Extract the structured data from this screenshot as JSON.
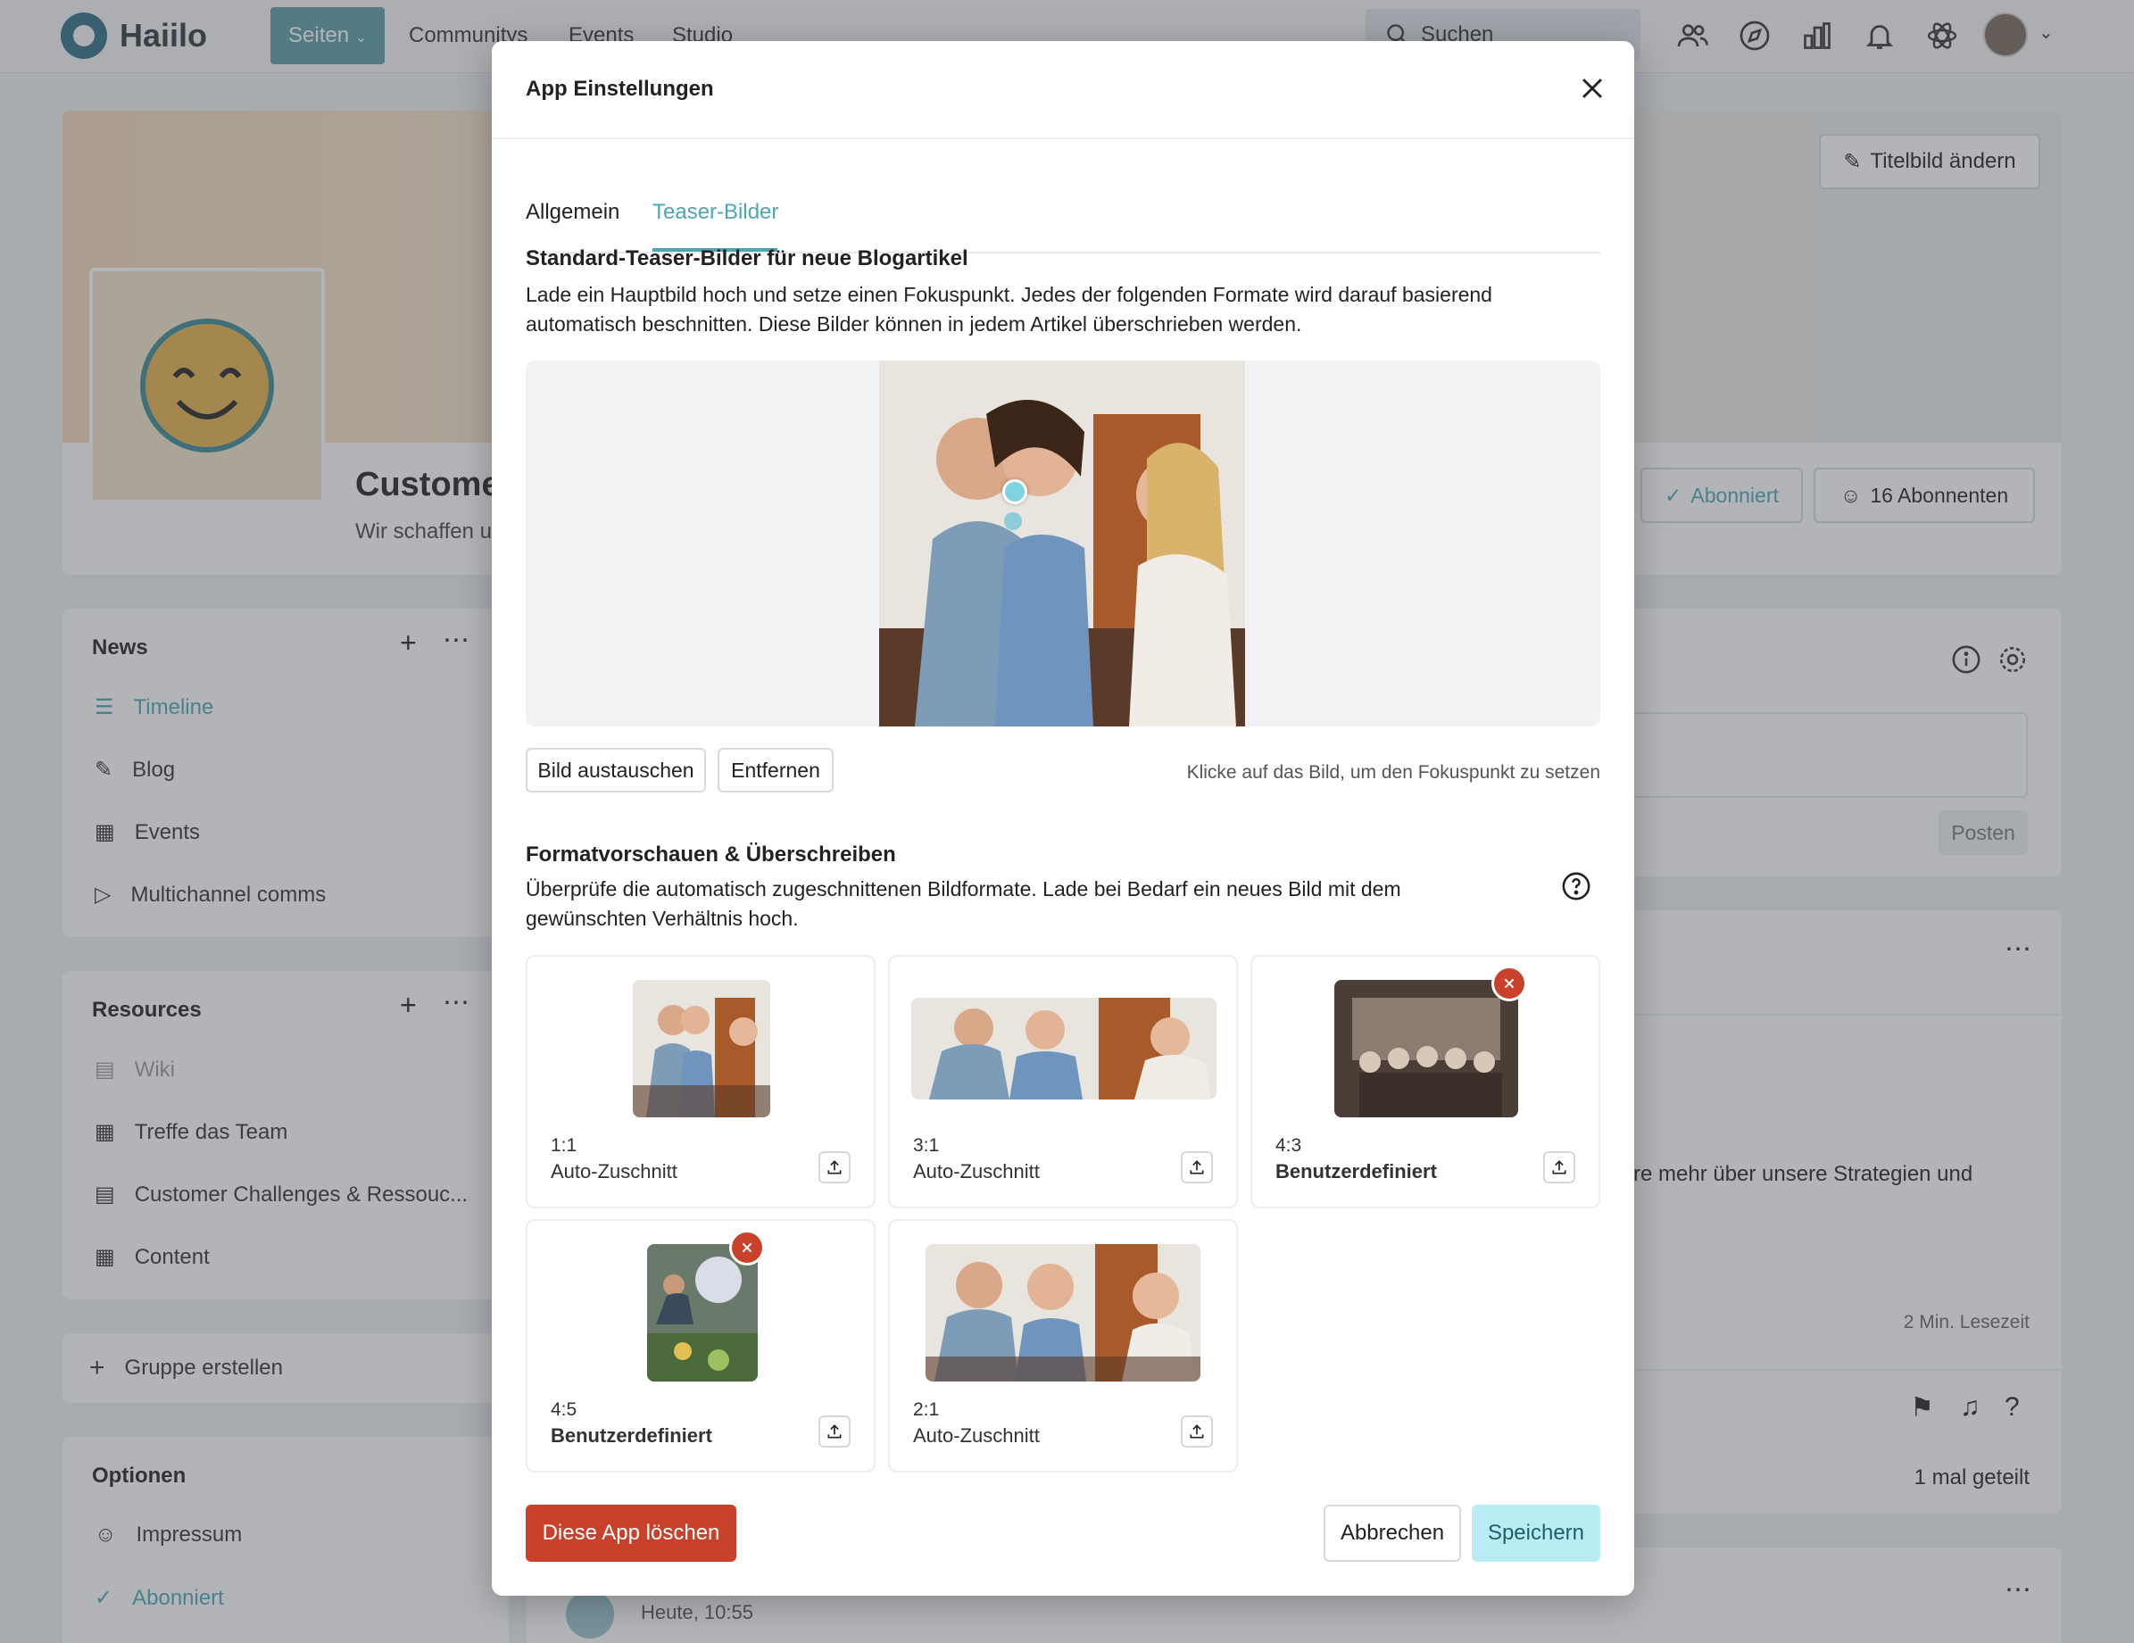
{
  "app": {
    "name": "Haiilo"
  },
  "nav": {
    "items": [
      {
        "label": "Seiten"
      },
      {
        "label": "Communitys"
      },
      {
        "label": "Events"
      },
      {
        "label": "Studio"
      }
    ],
    "search_placeholder": "Suchen"
  },
  "page": {
    "title": "Custome",
    "subtitle": "Wir schaffen u",
    "change_cover_label": "Titelbild ändern",
    "subscribed_label": "Abonniert",
    "subscribers_label": "16 Abonnenten",
    "post_button": "Posten",
    "read_time": "2 Min. Lesezeit",
    "snippet": "re mehr über unsere Strategien und",
    "shared": "1 mal geteilt",
    "timestamp": "Heute, 10:55"
  },
  "sidebar": {
    "news": {
      "title": "News",
      "items": [
        {
          "label": "Timeline"
        },
        {
          "label": "Blog"
        },
        {
          "label": "Events"
        },
        {
          "label": "Multichannel comms"
        }
      ]
    },
    "resources": {
      "title": "Resources",
      "items": [
        {
          "label": "Wiki"
        },
        {
          "label": "Treffe das Team"
        },
        {
          "label": "Customer Challenges & Ressouc..."
        },
        {
          "label": "Content"
        }
      ]
    },
    "create_group": "Gruppe erstellen",
    "options": {
      "title": "Optionen",
      "items": [
        {
          "label": "Impressum"
        },
        {
          "label": "Abonniert"
        }
      ]
    }
  },
  "modal": {
    "title": "App Einstellungen",
    "tabs": [
      {
        "label": "Allgemein"
      },
      {
        "label": "Teaser-Bilder"
      }
    ],
    "section1": {
      "title": "Standard-Teaser-Bilder für neue Blogartikel",
      "description": "Lade ein Hauptbild hoch und setze einen Fokuspunkt. Jedes der folgenden Formate wird darauf basierend automatisch beschnitten. Diese Bilder können in jedem Artikel überschrieben werden."
    },
    "replace_button": "Bild austauschen",
    "remove_button": "Entfernen",
    "focus_hint": "Klicke auf das Bild, um den Fokuspunkt zu setzen",
    "section2": {
      "title": "Formatvorschauen & Überschreiben",
      "description": "Überprüfe die automatisch zugeschnittenen Bildformate. Lade bei Bedarf ein neues Bild mit dem gewünschten Verhältnis hoch."
    },
    "formats": [
      {
        "ratio": "1:1",
        "mode": "Auto-Zuschnitt",
        "custom": false
      },
      {
        "ratio": "3:1",
        "mode": "Auto-Zuschnitt",
        "custom": false
      },
      {
        "ratio": "4:3",
        "mode": "Benutzerdefiniert",
        "custom": true
      },
      {
        "ratio": "4:5",
        "mode": "Benutzerdefiniert",
        "custom": true
      },
      {
        "ratio": "2:1",
        "mode": "Auto-Zuschnitt",
        "custom": false
      }
    ],
    "delete_app_button": "Diese App löschen",
    "cancel_button": "Abbrechen",
    "save_button": "Speichern"
  },
  "colors": {
    "accent": "#4aa7b5",
    "danger": "#c9412b",
    "save_bg": "#b9ecf3"
  }
}
